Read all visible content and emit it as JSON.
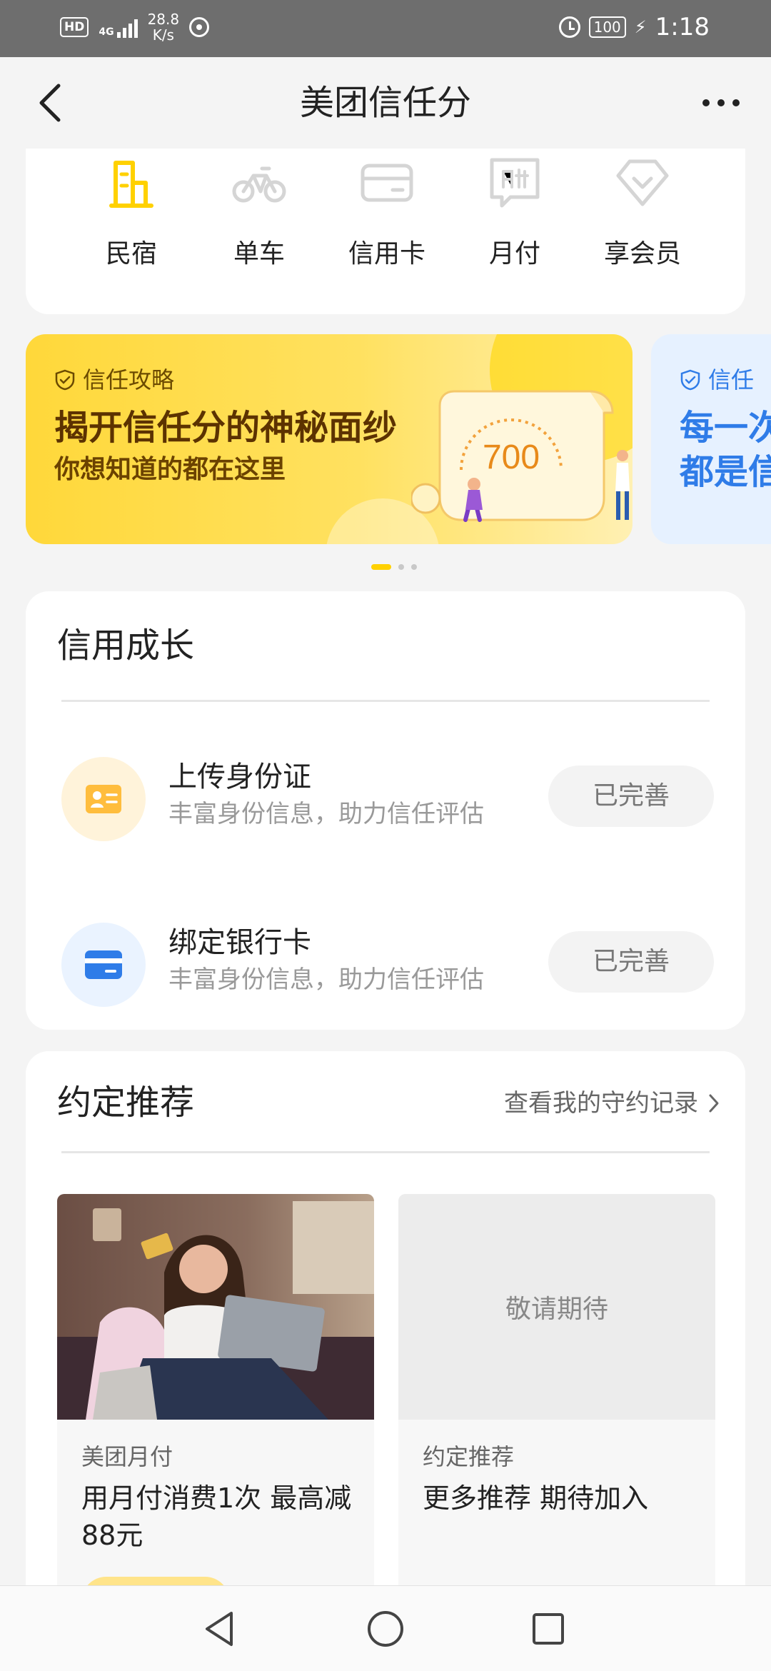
{
  "status_bar": {
    "hd": "HD",
    "network": "4G",
    "speed_value": "28.8",
    "speed_unit": "K/s",
    "battery": "100",
    "time": "1:18"
  },
  "nav": {
    "title": "美团信任分"
  },
  "services": [
    {
      "label": "民宿",
      "icon": "building-icon",
      "active": true
    },
    {
      "label": "单车",
      "icon": "bicycle-icon",
      "active": false
    },
    {
      "label": "信用卡",
      "icon": "credit-card-icon",
      "active": false
    },
    {
      "label": "月付",
      "icon": "monthly-pay-icon",
      "active": false
    },
    {
      "label": "享会员",
      "icon": "membership-icon",
      "active": false
    }
  ],
  "banners": [
    {
      "tag": "信任攻略",
      "title": "揭开信任分的神秘面纱",
      "subtitle": "你想知道的都在这里",
      "score": "700"
    },
    {
      "tag": "信任",
      "title_line1": "每一次",
      "title_line2": "都是信"
    }
  ],
  "carousel": {
    "count": 3,
    "active_index": 0
  },
  "growth": {
    "title": "信用成长",
    "tasks": [
      {
        "title": "上传身份证",
        "subtitle": "丰富身份信息，助力信任评估",
        "button": "已完善",
        "icon": "id-card-icon"
      },
      {
        "title": "绑定银行卡",
        "subtitle": "丰富身份信息，助力信任评估",
        "button": "已完善",
        "icon": "bank-card-icon"
      }
    ]
  },
  "agreement": {
    "title": "约定推荐",
    "link": "查看我的守约记录",
    "cards": [
      {
        "tag": "美团月付",
        "description": "用月付消费1次 最高减88元"
      },
      {
        "placeholder": "敬请期待",
        "tag": "约定推荐",
        "description": "更多推荐 期待加入"
      }
    ]
  },
  "colors": {
    "accent_yellow": "#FFD100",
    "icon_gray": "#D5D5D5",
    "blue": "#2F7CE8",
    "background": "#F4F4F4"
  }
}
